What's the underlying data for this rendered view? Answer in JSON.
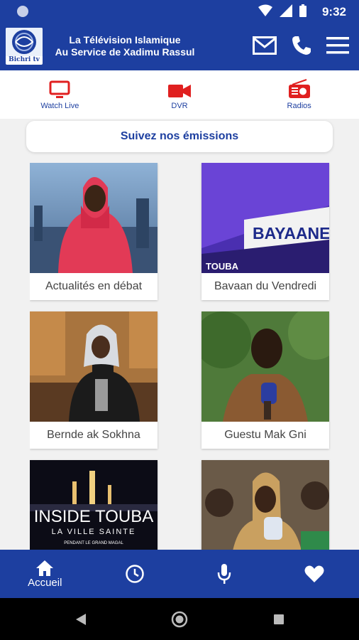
{
  "status": {
    "time": "9:32"
  },
  "app": {
    "title_line1": "La Télévision Islamique",
    "title_line2": "Au Service de Xadimu Rassul",
    "logo_text": "Bichri tv"
  },
  "tabs": [
    {
      "label": "Watch Live",
      "icon": "tv-icon"
    },
    {
      "label": "DVR",
      "icon": "video-camera-icon"
    },
    {
      "label": "Radios",
      "icon": "radio-icon"
    }
  ],
  "section": {
    "title": "Suivez nos émissions"
  },
  "shows": [
    {
      "title": "Actualités en débat"
    },
    {
      "title": "Bavaan du Vendredi",
      "thumb_text": "BAYAANE",
      "thumb_subtext": "TOUBA"
    },
    {
      "title": "Bernde ak Sokhna"
    },
    {
      "title": "Guestu Mak Gni"
    },
    {
      "title": "",
      "thumb_text": "INSIDE TOUBA",
      "thumb_subtext": "LA VILLE SAINTE",
      "thumb_caption": "PENDANT LE GRAND MAGAL"
    },
    {
      "title": ""
    }
  ],
  "bottom_nav": [
    {
      "label": "Accueil",
      "icon": "home-icon"
    },
    {
      "label": "",
      "icon": "clock-icon"
    },
    {
      "label": "",
      "icon": "microphone-icon"
    },
    {
      "label": "",
      "icon": "heart-icon"
    }
  ],
  "colors": {
    "primary": "#1d3fa0",
    "accent": "#e02020"
  }
}
